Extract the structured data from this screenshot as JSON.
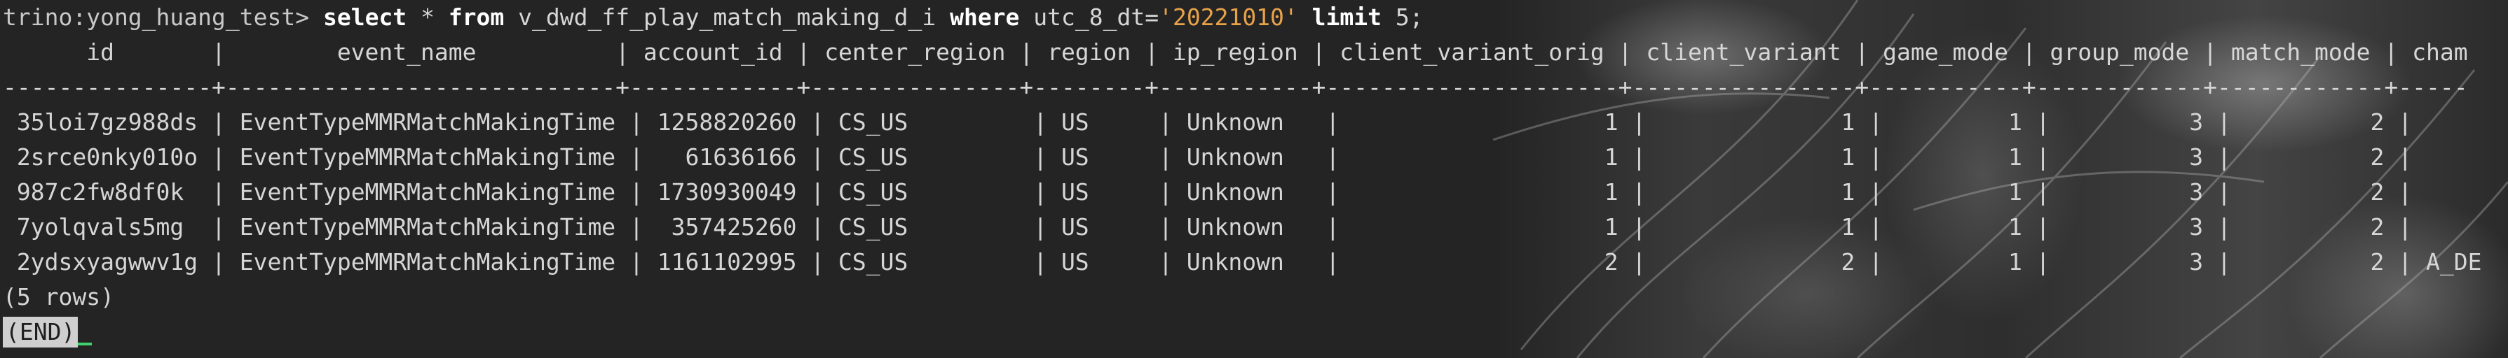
{
  "terminal": {
    "prompt": "trino:yong_huang_test>",
    "query": {
      "kw_select": "select",
      "star": "*",
      "kw_from": "from",
      "table": "v_dwd_ff_play_match_making_d_i",
      "kw_where": "where",
      "condition": "utc_8_dt=",
      "value": "'20221010'",
      "kw_limit": "limit",
      "limit_value": "5;"
    },
    "header_line": "      id       |        event_name          | account_id | center_region | region | ip_region | client_variant_orig | client_variant | game_mode | group_mode | match_mode | cham",
    "separator_line": "---------------+----------------------------+------------+---------------+--------+-----------+---------------------+----------------+-----------+------------+------------+-----",
    "rows": [
      " 35loi7gz988ds | EventTypeMMRMatchMakingTime | 1258820260 | CS_US         | US     | Unknown   |                   1 |              1 |         1 |          3 |          2 |",
      " 2srce0nky010o | EventTypeMMRMatchMakingTime |   61636166 | CS_US         | US     | Unknown   |                   1 |              1 |         1 |          3 |          2 |",
      " 987c2fw8df0k  | EventTypeMMRMatchMakingTime | 1730930049 | CS_US         | US     | Unknown   |                   1 |              1 |         1 |          3 |          2 |",
      " 7yolqvals5mg  | EventTypeMMRMatchMakingTime |  357425260 | CS_US         | US     | Unknown   |                   1 |              1 |         1 |          3 |          2 |",
      " 2ydsxyagwwv1g | EventTypeMMRMatchMakingTime | 1161102995 | CS_US         | US     | Unknown   |                   2 |              2 |         1 |          3 |          2 | A_DE"
    ],
    "row_count": "(5 rows)",
    "pager_end": "(END)"
  },
  "colors": {
    "background": "#242424",
    "text": "#d6d6d6",
    "string_literal": "#e8a24a",
    "cursor": "#3fd36b"
  }
}
